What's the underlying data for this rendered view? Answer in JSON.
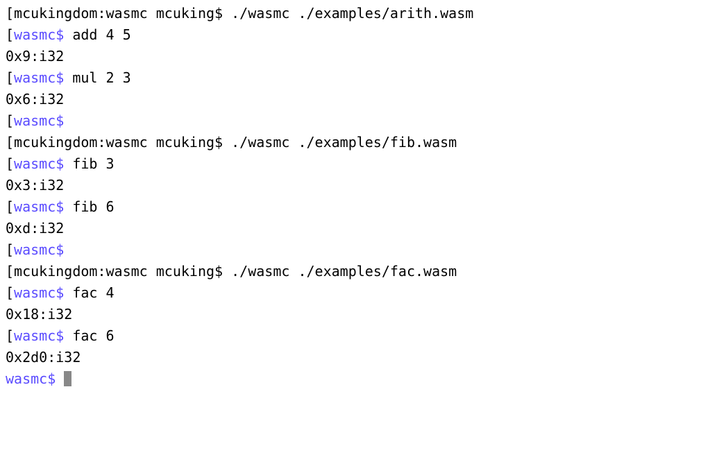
{
  "lines": [
    {
      "segments": [
        {
          "cls": "bracket",
          "text": "["
        },
        {
          "cls": "txt",
          "text": "mcukingdom:wasmc mcuking$ ./wasmc ./examples/arith.wasm"
        }
      ]
    },
    {
      "segments": [
        {
          "cls": "bracket",
          "text": "["
        },
        {
          "cls": "prompt-blue",
          "text": "wasmc$"
        },
        {
          "cls": "txt",
          "text": " add 4 5"
        }
      ]
    },
    {
      "segments": [
        {
          "cls": "txt",
          "text": "0x9:i32"
        }
      ]
    },
    {
      "segments": [
        {
          "cls": "bracket",
          "text": "["
        },
        {
          "cls": "prompt-blue",
          "text": "wasmc$"
        },
        {
          "cls": "txt",
          "text": " mul 2 3"
        }
      ]
    },
    {
      "segments": [
        {
          "cls": "txt",
          "text": "0x6:i32"
        }
      ]
    },
    {
      "segments": [
        {
          "cls": "bracket",
          "text": "["
        },
        {
          "cls": "prompt-blue",
          "text": "wasmc$"
        }
      ]
    },
    {
      "segments": [
        {
          "cls": "bracket",
          "text": "["
        },
        {
          "cls": "txt",
          "text": "mcukingdom:wasmc mcuking$ ./wasmc ./examples/fib.wasm"
        }
      ]
    },
    {
      "segments": [
        {
          "cls": "bracket",
          "text": "["
        },
        {
          "cls": "prompt-blue",
          "text": "wasmc$"
        },
        {
          "cls": "txt",
          "text": " fib 3"
        }
      ]
    },
    {
      "segments": [
        {
          "cls": "txt",
          "text": "0x3:i32"
        }
      ]
    },
    {
      "segments": [
        {
          "cls": "bracket",
          "text": "["
        },
        {
          "cls": "prompt-blue",
          "text": "wasmc$"
        },
        {
          "cls": "txt",
          "text": " fib 6"
        }
      ]
    },
    {
      "segments": [
        {
          "cls": "txt",
          "text": "0xd:i32"
        }
      ]
    },
    {
      "segments": [
        {
          "cls": "bracket",
          "text": "["
        },
        {
          "cls": "prompt-blue",
          "text": "wasmc$"
        }
      ]
    },
    {
      "segments": [
        {
          "cls": "bracket",
          "text": "["
        },
        {
          "cls": "txt",
          "text": "mcukingdom:wasmc mcuking$ ./wasmc ./examples/fac.wasm"
        }
      ]
    },
    {
      "segments": [
        {
          "cls": "bracket",
          "text": "["
        },
        {
          "cls": "prompt-blue",
          "text": "wasmc$"
        },
        {
          "cls": "txt",
          "text": " fac 4"
        }
      ]
    },
    {
      "segments": [
        {
          "cls": "txt",
          "text": "0x18:i32"
        }
      ]
    },
    {
      "segments": [
        {
          "cls": "bracket",
          "text": "["
        },
        {
          "cls": "prompt-blue",
          "text": "wasmc$"
        },
        {
          "cls": "txt",
          "text": " fac 6"
        }
      ]
    },
    {
      "segments": [
        {
          "cls": "txt",
          "text": "0x2d0:i32"
        }
      ]
    },
    {
      "segments": [
        {
          "cls": "prompt-blue",
          "text": "wasmc$"
        },
        {
          "cls": "txt",
          "text": " "
        }
      ],
      "cursor": true
    }
  ]
}
